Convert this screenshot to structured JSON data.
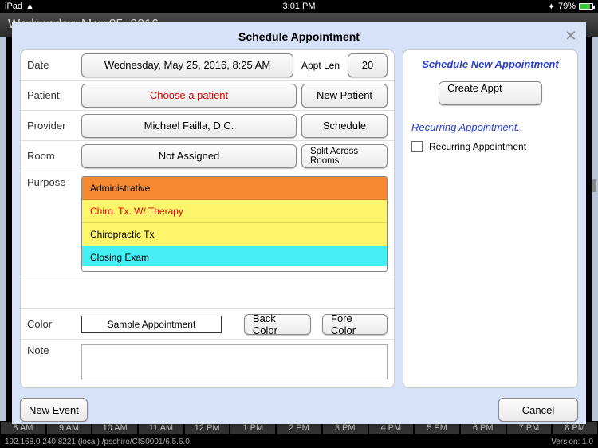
{
  "status": {
    "carrier": "iPad",
    "time": "3:01 PM",
    "battery": "79%"
  },
  "bg": {
    "date": "Wednesday, May 25, 2016",
    "hours": [
      "8 AM",
      "9 AM",
      "10 AM",
      "11 AM",
      "12 PM",
      "1 PM",
      "2 PM",
      "3 PM",
      "4 PM",
      "5 PM",
      "6 PM",
      "7 PM",
      "8 PM"
    ]
  },
  "footer": {
    "left": "192.168.0.240:8221 (local) /pschiro/CIS0001/6.5.6.0",
    "right": "Version: 1.0"
  },
  "modal": {
    "title": "Schedule Appointment",
    "labels": {
      "date": "Date",
      "apptLen": "Appt Len",
      "patient": "Patient",
      "provider": "Provider",
      "room": "Room",
      "purpose": "Purpose",
      "color": "Color",
      "note": "Note"
    },
    "values": {
      "date": "Wednesday, May 25, 2016, 8:25 AM",
      "apptLen": "20",
      "patient": "Choose a patient",
      "provider": "Michael Failla, D.C.",
      "room": "Not Assigned",
      "colorSample": "Sample Appointment"
    },
    "buttons": {
      "newPatient": "New Patient",
      "schedule": "Schedule",
      "splitRooms": "Split Across Rooms",
      "backColor": "Back Color",
      "foreColor": "Fore Color",
      "newEvent": "New Event",
      "cancel": "Cancel",
      "createAppt": "Create Appt"
    },
    "purposes": [
      {
        "label": "Administrative",
        "bg": "#f58a33",
        "fg": "#000"
      },
      {
        "label": "Chiro. Tx. W/ Therapy",
        "bg": "#fef56a",
        "fg": "#d00"
      },
      {
        "label": "Chiropractic Tx",
        "bg": "#fef56a",
        "fg": "#000"
      },
      {
        "label": "Closing Exam",
        "bg": "#45f0f5",
        "fg": "#000"
      }
    ],
    "sidebar": {
      "newTitle": "Schedule New Appointment",
      "recurringTitle": "Recurring Appointment..",
      "recurringCheck": "Recurring Appointment"
    }
  }
}
